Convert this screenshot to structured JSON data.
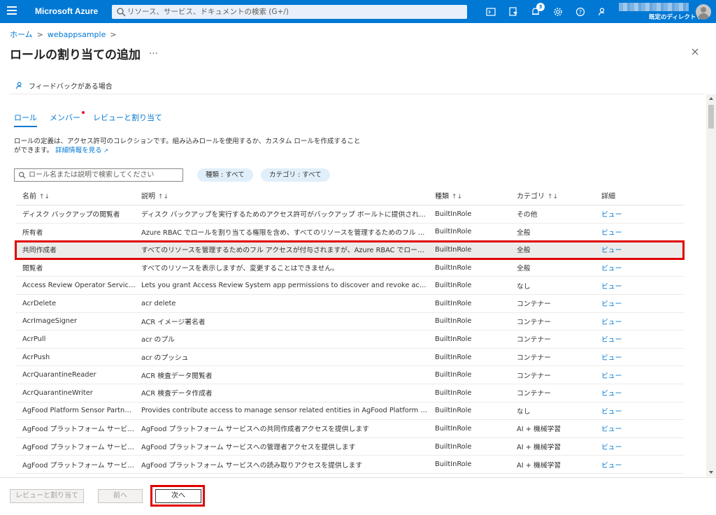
{
  "topbar": {
    "brand": "Microsoft Azure",
    "search_placeholder": "リソース、サービス、ドキュメントの検索 (G+/)",
    "notification_count": "3",
    "directory": "既定のディレクトリ"
  },
  "breadcrumb": {
    "home": "ホーム",
    "sep1": ">",
    "resource": "webappsample",
    "sep2": ">"
  },
  "page": {
    "title": "ロールの割り当ての追加",
    "more": "…"
  },
  "feedback": {
    "label": "フィードバックがある場合"
  },
  "tabs": [
    {
      "label": "ロール"
    },
    {
      "label": "メンバー"
    },
    {
      "label": "レビューと割り当て"
    }
  ],
  "description": {
    "text": "ロールの定義は、アクセス許可のコレクションです。組み込みロールを使用するか、カスタム ロールを作成することができます。",
    "link": "詳細情報を見る"
  },
  "filters": {
    "search_placeholder": "ロール名または説明で検索してください",
    "type_pill": "種類 : すべて",
    "category_pill": "カテゴリ : すべて"
  },
  "table": {
    "headers": {
      "name": "名前",
      "description": "説明",
      "type": "種類",
      "category": "カテゴリ",
      "details": "詳細"
    },
    "sort_glyph": "↑↓",
    "rows": [
      {
        "name": "ディスク バックアップの閲覧者",
        "description": "ディスク バックアップを実行するためのアクセス許可がバックアップ ボールトに提供されます。",
        "type": "BuiltInRole",
        "category": "その他",
        "details": "ビュー"
      },
      {
        "name": "所有者",
        "description": "Azure RBAC でロールを割り当てる権限を含め、すべてのリソースを管理するためのフル アクセスを付...",
        "type": "BuiltInRole",
        "category": "全般",
        "details": "ビュー"
      },
      {
        "name": "共同作成者",
        "description": "すべてのリソースを管理するためのフル アクセスが付与されますが、Azure RBAC でロールを割り当てた...",
        "type": "BuiltInRole",
        "category": "全般",
        "details": "ビュー"
      },
      {
        "name": "閲覧者",
        "description": "すべてのリソースを表示しますが、変更することはできません。",
        "type": "BuiltInRole",
        "category": "全般",
        "details": "ビュー"
      },
      {
        "name": "Access Review Operator Service R...",
        "description": "Lets you grant Access Review System app permissions to discover and revoke access as ...",
        "type": "BuiltInRole",
        "category": "なし",
        "details": "ビュー"
      },
      {
        "name": "AcrDelete",
        "description": "acr delete",
        "type": "BuiltInRole",
        "category": "コンテナー",
        "details": "ビュー"
      },
      {
        "name": "AcrImageSigner",
        "description": "ACR イメージ署名者",
        "type": "BuiltInRole",
        "category": "コンテナー",
        "details": "ビュー"
      },
      {
        "name": "AcrPull",
        "description": "acr のプル",
        "type": "BuiltInRole",
        "category": "コンテナー",
        "details": "ビュー"
      },
      {
        "name": "AcrPush",
        "description": "acr のプッシュ",
        "type": "BuiltInRole",
        "category": "コンテナー",
        "details": "ビュー"
      },
      {
        "name": "AcrQuarantineReader",
        "description": "ACR 検査データ閲覧者",
        "type": "BuiltInRole",
        "category": "コンテナー",
        "details": "ビュー"
      },
      {
        "name": "AcrQuarantineWriter",
        "description": "ACR 検査データ作成者",
        "type": "BuiltInRole",
        "category": "コンテナー",
        "details": "ビュー"
      },
      {
        "name": "AgFood Platform Sensor Partner C...",
        "description": "Provides contribute access to manage sensor related entities in AgFood Platform Service",
        "type": "BuiltInRole",
        "category": "なし",
        "details": "ビュー"
      },
      {
        "name": "AgFood プラットフォーム サービス共同...",
        "description": "AgFood プラットフォーム サービスへの共同作成者アクセスを提供します",
        "type": "BuiltInRole",
        "category": "AI + 機械学習",
        "details": "ビュー"
      },
      {
        "name": "AgFood プラットフォーム サービス管理者",
        "description": "AgFood プラットフォーム サービスへの管理者アクセスを提供します",
        "type": "BuiltInRole",
        "category": "AI + 機械学習",
        "details": "ビュー"
      },
      {
        "name": "AgFood プラットフォーム サービス閲覧者",
        "description": "AgFood プラットフォーム サービスへの読み取りアクセスを提供します",
        "type": "BuiltInRole",
        "category": "AI + 機械学習",
        "details": "ビュー"
      }
    ]
  },
  "footer": {
    "review_button": "レビューと割り当て",
    "prev_button": "前へ",
    "next_button": "次へ"
  },
  "colors": {
    "azure_blue": "#0078d4",
    "highlight_red": "#e00000",
    "selected_row": "#edebe9"
  }
}
